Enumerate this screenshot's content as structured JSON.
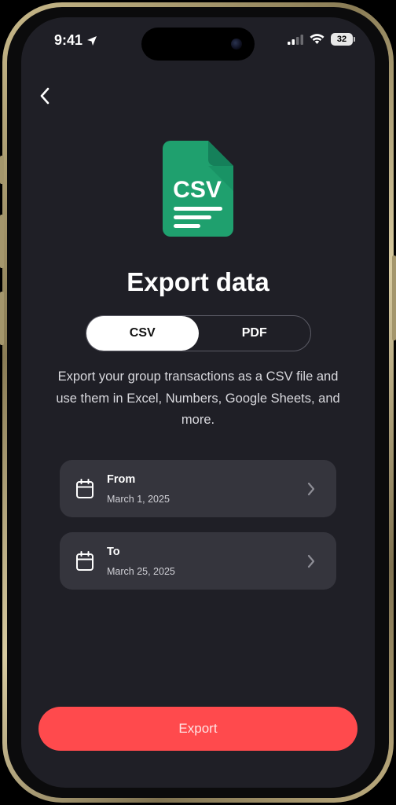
{
  "status_bar": {
    "time": "9:41",
    "battery_level": "32",
    "location_icon": "location-arrow-icon",
    "signal_icon": "cellular-signal-icon",
    "wifi_icon": "wifi-icon"
  },
  "nav": {
    "back_icon": "chevron-left-icon"
  },
  "hero": {
    "file_icon": "csv-file-icon",
    "file_icon_text": "CSV",
    "file_icon_color": "#1fa06e",
    "title": "Export data"
  },
  "format_toggle": {
    "options": [
      "CSV",
      "PDF"
    ],
    "selected": "CSV"
  },
  "description": "Export your group transactions as a CSV file and use them in Excel, Numbers, Google Sheets, and more.",
  "date_range": {
    "from": {
      "label": "From",
      "value": "March 1, 2025",
      "icon": "calendar-icon"
    },
    "to": {
      "label": "To",
      "value": "March 25, 2025",
      "icon": "calendar-icon"
    }
  },
  "actions": {
    "export_label": "Export",
    "export_color": "#ff4a4d"
  }
}
